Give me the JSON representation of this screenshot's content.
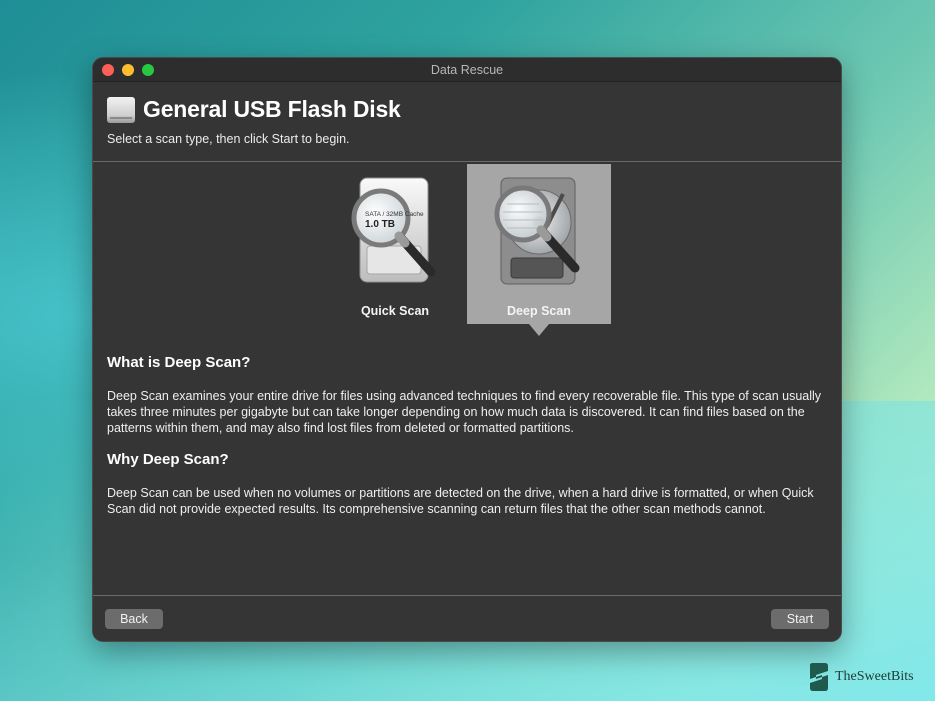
{
  "window": {
    "title": "Data Rescue"
  },
  "header": {
    "disk_name": "General USB Flash Disk",
    "instruction": "Select a scan type, then click Start to begin."
  },
  "scan_options": [
    {
      "label": "Quick Scan",
      "selected": false,
      "drive_label_line1": "SATA / 32MB Cache",
      "drive_label_line2": "1.0 TB"
    },
    {
      "label": "Deep Scan",
      "selected": true
    }
  ],
  "description": {
    "what_heading": "What is Deep Scan?",
    "what_text": "Deep Scan examines your entire drive for files using advanced techniques to find every recoverable file. This type of scan usually takes three minutes per gigabyte but can take longer depending on how much data is discovered. It can find files based on the patterns within them, and may also find lost files from deleted or formatted partitions.",
    "why_heading": "Why Deep Scan?",
    "why_text": "Deep Scan can be used when no volumes or partitions are detected on the drive, when a hard drive is formatted, or when Quick Scan did not provide expected results. Its comprehensive scanning can return files that the other scan methods cannot."
  },
  "footer": {
    "back_label": "Back",
    "start_label": "Start"
  },
  "watermark": {
    "text": "TheSweetBits"
  },
  "colors": {
    "window_bg": "#353535",
    "selected_bg": "#a6a6a6",
    "button_bg": "#6c6c6c",
    "close": "#fe5f57",
    "minimize": "#febc2e",
    "maximize": "#28c840"
  }
}
